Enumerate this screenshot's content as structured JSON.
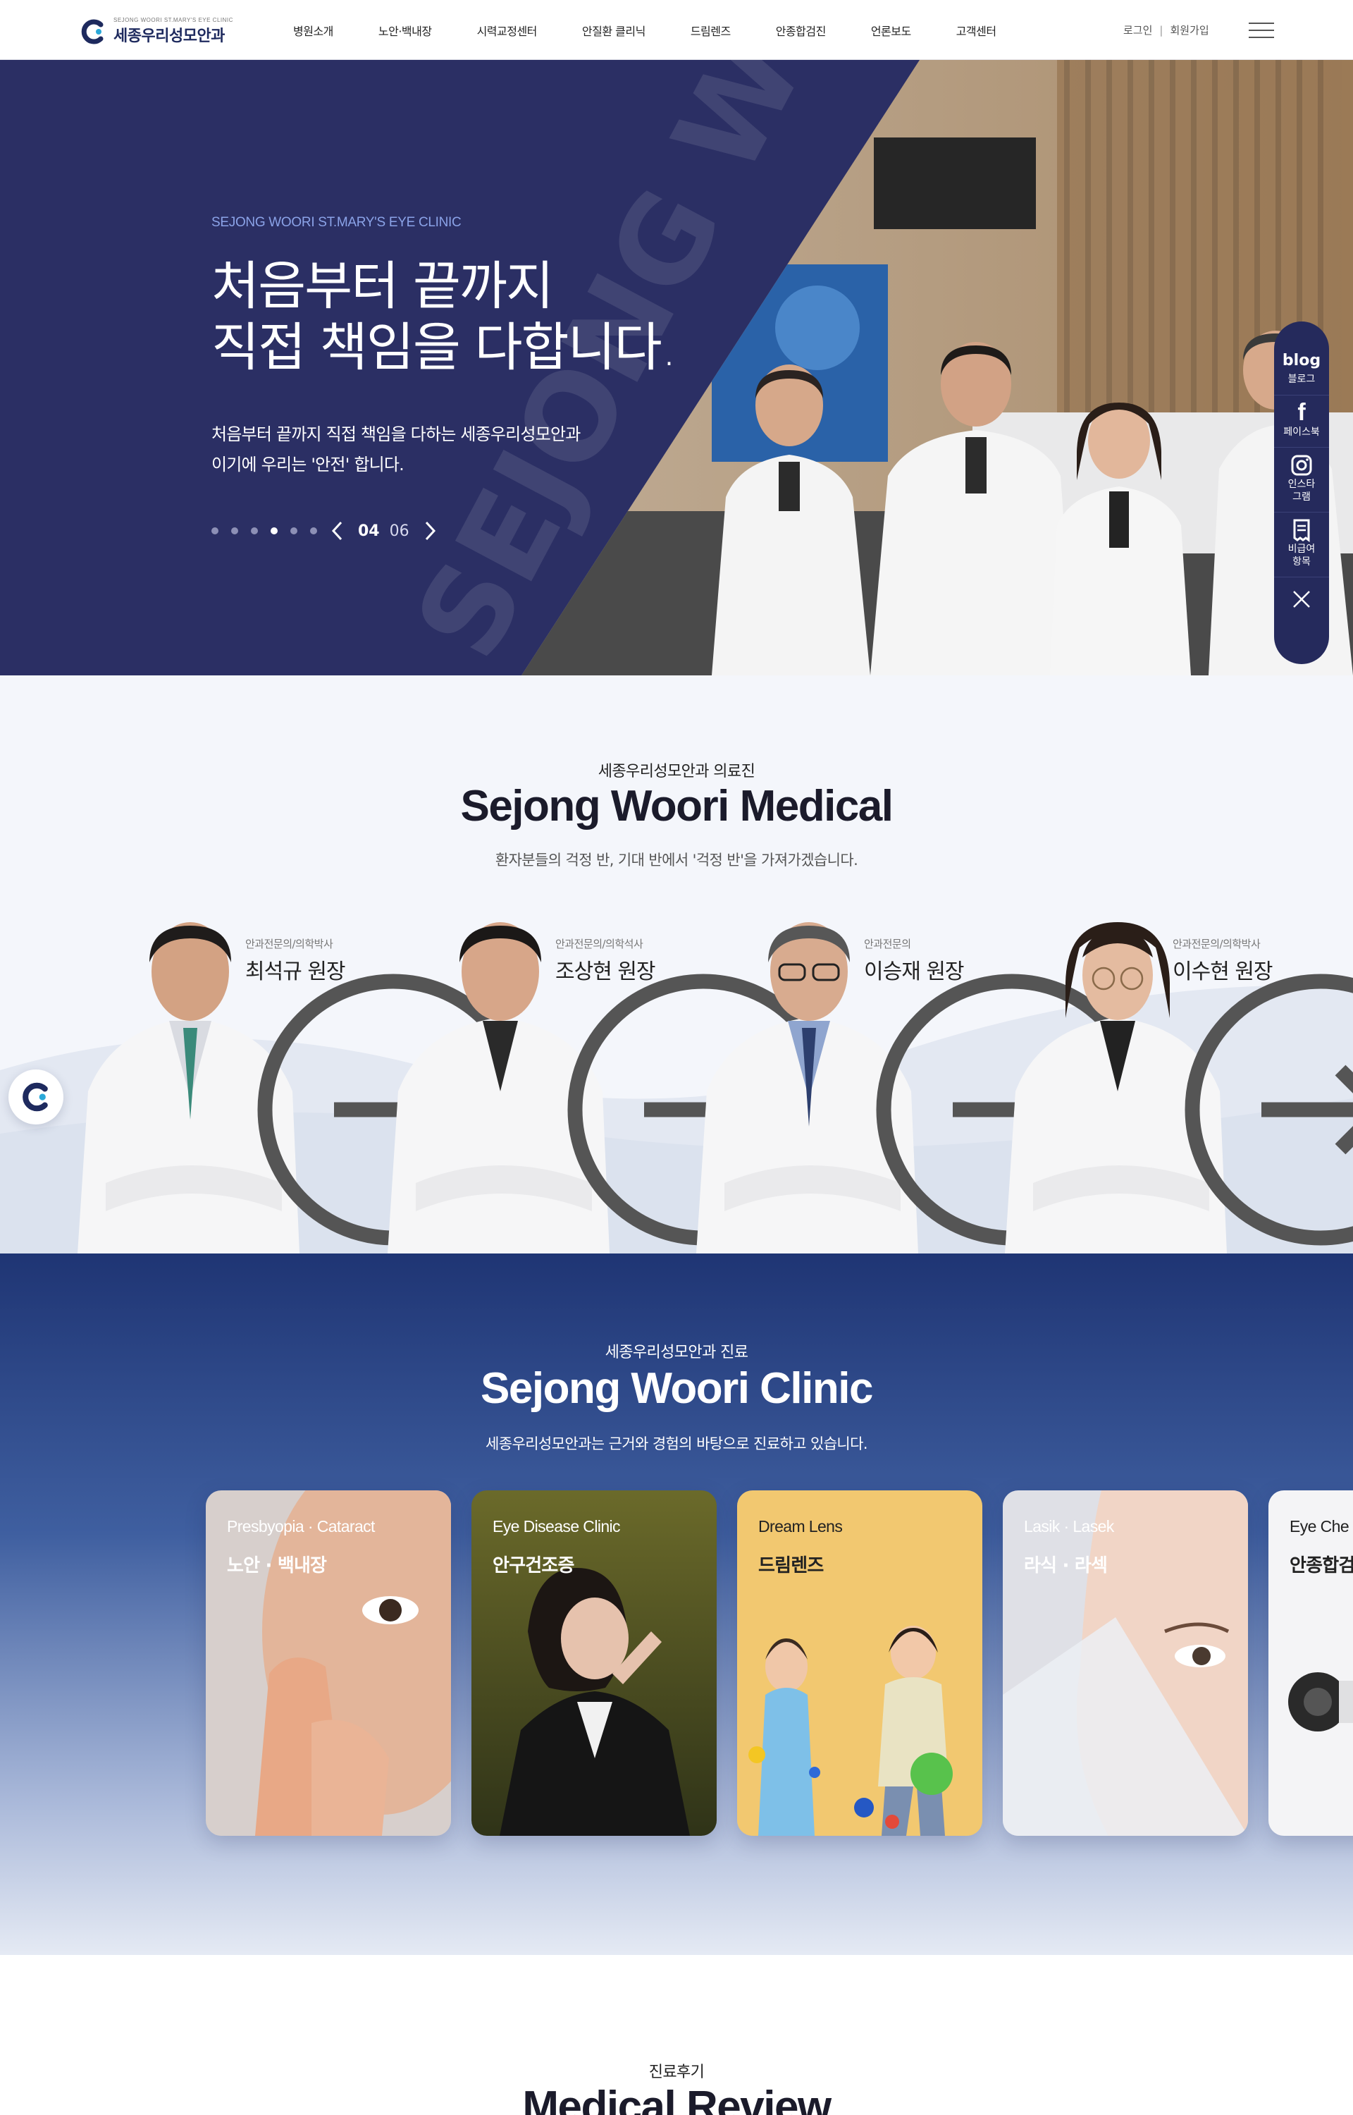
{
  "header": {
    "logo_sub": "SEJONG WOORI ST.MARY'S EYE CLINIC",
    "logo_main": "세종우리성모안과",
    "nav": [
      "병원소개",
      "노안·백내장",
      "시력교정센터",
      "안질환 클리닉",
      "드림렌즈",
      "안종합검진",
      "언론보도",
      "고객센터"
    ],
    "login": "로그인",
    "separator": "|",
    "join": "회원가입",
    "menu_icon": "hamburger-icon"
  },
  "hero": {
    "kicker": "SEJONG WOORI ST.MARY'S EYE CLINIC",
    "title_line1": "처음부터 끝까지",
    "title_line2": "직접 책임을 다합니다.",
    "desc_line1": "처음부터 끝까지 직접 책임을 다하는 세종우리성모안과",
    "desc_line2": "이기에 우리는 '안전' 합니다.",
    "watermark": "SEJONG WOORI",
    "current_slide": "04",
    "total_slides": "06",
    "slide_count": 6,
    "active_index": 3,
    "colors": {
      "bg": "#2b2f64",
      "kicker": "#8ba3e8"
    }
  },
  "quick_menu": {
    "items": [
      {
        "icon": "blog-icon",
        "icon_text": "blog",
        "label": "블로그"
      },
      {
        "icon": "facebook-icon",
        "icon_text": "f",
        "label": "페이스북"
      },
      {
        "icon": "instagram-icon",
        "icon_text": "",
        "label": "인스타\n그램"
      },
      {
        "icon": "receipt-icon",
        "icon_text": "",
        "label": "비급여\n항목"
      }
    ],
    "close_icon": "close-icon"
  },
  "staff": {
    "kicker": "세종우리성모안과 의료진",
    "title": "Sejong Woori Medical",
    "desc": "환자분들의 걱정 반, 기대 반에서 '걱정 반'을 가져가겠습니다.",
    "doctors": [
      {
        "title": "안과전문의/의학박사",
        "name": "최석규 원장"
      },
      {
        "title": "안과전문의/의학석사",
        "name": "조상현 원장"
      },
      {
        "title": "안과전문의",
        "name": "이승재 원장"
      },
      {
        "title": "안과전문의/의학박사",
        "name": "이수현 원장"
      }
    ]
  },
  "clinic": {
    "kicker": "세종우리성모안과 진료",
    "title": "Sejong Woori Clinic",
    "desc": "세종우리성모안과는 근거와 경험의 바탕으로 진료하고 있습니다.",
    "cards": [
      {
        "en": "Presbyopia · Cataract",
        "ko": "노안 · 백내장"
      },
      {
        "en": "Eye Disease Clinic",
        "ko": "안구건조증"
      },
      {
        "en": "Dream Lens",
        "ko": "드림렌즈"
      },
      {
        "en": "Lasik · Lasek",
        "ko": "라식 · 라섹"
      },
      {
        "en": "Eye Che",
        "ko": "안종합검"
      }
    ]
  },
  "review": {
    "kicker": "진료후기",
    "title": "Medical Review"
  }
}
